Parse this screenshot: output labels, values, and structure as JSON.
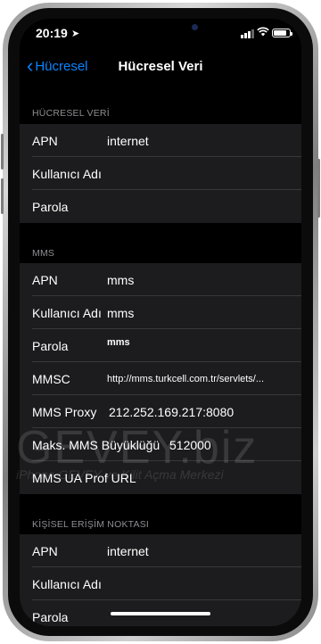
{
  "status": {
    "time": "20:19"
  },
  "nav": {
    "back_label": "Hücresel",
    "title": "Hücresel Veri"
  },
  "sections": [
    {
      "header": "HÜCRESEL VERİ",
      "rows": [
        {
          "label": "APN",
          "value": "internet"
        },
        {
          "label": "Kullanıcı Adı",
          "value": ""
        },
        {
          "label": "Parola",
          "value": ""
        }
      ]
    },
    {
      "header": "MMS",
      "rows": [
        {
          "label": "APN",
          "value": "mms"
        },
        {
          "label": "Kullanıcı Adı",
          "value": "mms"
        },
        {
          "label": "Parola",
          "value": "mms"
        },
        {
          "label": "MMSC",
          "value": "http://mms.turkcell.com.tr/servlets/..."
        },
        {
          "label": "MMS Proxy",
          "value": "212.252.169.217:8080"
        },
        {
          "label": "Maks. MMS Büyüklüğü",
          "value": "512000"
        },
        {
          "label": "MMS UA Prof URL",
          "value": ""
        }
      ]
    },
    {
      "header": "KİŞİSEL ERİŞİM NOKTASI",
      "rows": [
        {
          "label": "APN",
          "value": "internet"
        },
        {
          "label": "Kullanıcı Adı",
          "value": ""
        },
        {
          "label": "Parola",
          "value": ""
        }
      ]
    }
  ],
  "watermark": {
    "line1": "GEVEY.biz",
    "line2": "iPhone GEVEY ve Kilit Açma Merkezi"
  },
  "colors": {
    "accent": "#0a84ff",
    "background": "#000000",
    "cell": "#1c1c1e",
    "header_text": "#8e8e93"
  }
}
